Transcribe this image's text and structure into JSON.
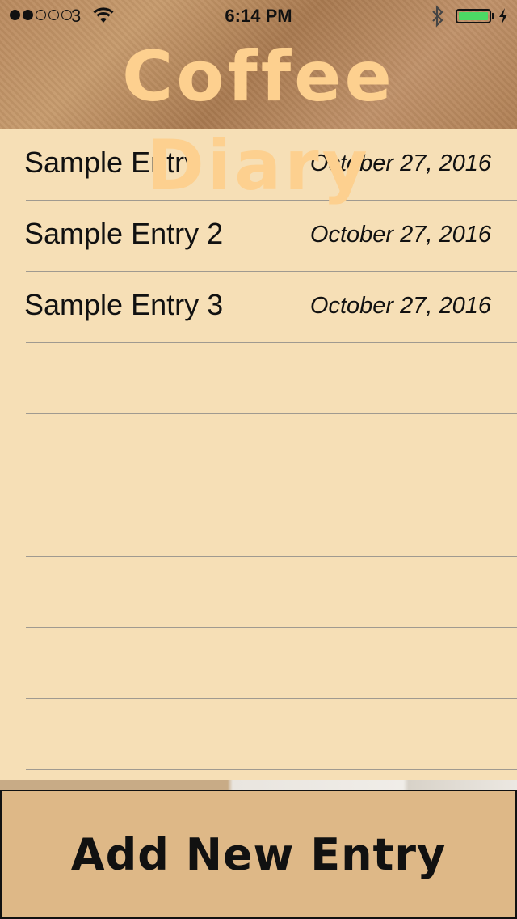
{
  "status_bar": {
    "carrier": "3",
    "time": "6:14 PM",
    "battery_level": 1.0,
    "battery_color": "#4cd964",
    "icons": [
      "signal-dots-icon",
      "wifi-icon",
      "bluetooth-icon",
      "battery-icon",
      "charging-bolt-icon"
    ]
  },
  "header": {
    "title": "Coffee Diary",
    "title_color": "#fdd08f"
  },
  "entries": [
    {
      "title": "Sample Entry",
      "date": "October 27, 2016"
    },
    {
      "title": "Sample Entry 2",
      "date": "October 27, 2016"
    },
    {
      "title": "Sample Entry 3",
      "date": "October 27, 2016"
    }
  ],
  "add_button": {
    "label": "Add New Entry",
    "background": "#deb887"
  },
  "colors": {
    "list_background": "#f6dfb6",
    "separator": "#a09a90"
  }
}
